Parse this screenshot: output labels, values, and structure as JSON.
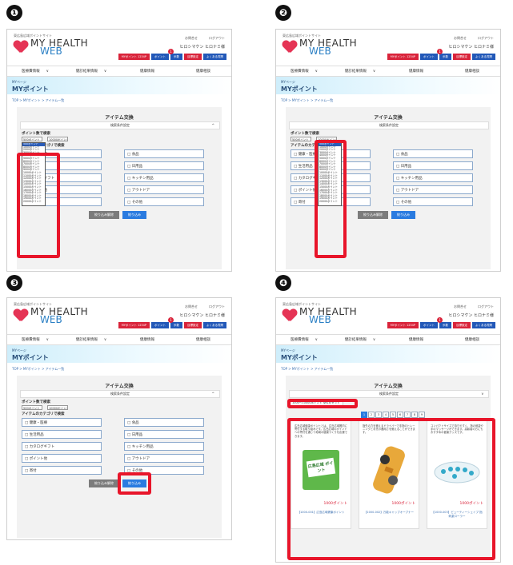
{
  "markers": [
    "❶",
    "❷",
    "❸",
    "❹"
  ],
  "header": {
    "tagline": "東広島広域ポイントサイト",
    "logo_main": "MY HEALTH",
    "logo_sub": "WEB",
    "top_link_1": "お問合せ",
    "top_link_2": "ログアウト",
    "user_line": "ヒロシマケン ヒロナミ様",
    "buttons": [
      "MYポイント 1234P",
      "ポイント",
      "歩数",
      "目標設定",
      "よくある質問"
    ],
    "badge": "1",
    "nav": [
      "医療費情報",
      "健診結果情報",
      "健康情報",
      "健康相談"
    ]
  },
  "page": {
    "band_small": "MYページ",
    "band_title": "MYポイント",
    "crumb": "TOP > MYポイント > アイテム一覧",
    "title": "アイテム交換",
    "subtitle": "検索条件設定",
    "points_label": "ポイント数で検索",
    "category_label": "アイテムのカテゴリで検索",
    "categories": [
      "健康・医療",
      "食品",
      "生活用品",
      "日用品",
      "カタログギフト",
      "キッチン用品",
      "ポイント他",
      "アウトドア",
      "寄付",
      "その他"
    ],
    "clear_label": "絞り込み解除",
    "search_label": "絞り込み",
    "select_from": "500ポイント",
    "select_to": "10000ポイント"
  },
  "dropdown_options": [
    "500ポイント",
    "1000ポイント",
    "2000ポイント",
    "3000ポイント",
    "4000ポイント",
    "5000ポイント",
    "6000ポイント",
    "7000ポイント",
    "8000ポイント",
    "9000ポイント",
    "10000ポイント",
    "11000ポイント",
    "12000ポイント",
    "13000ポイント",
    "14000ポイント",
    "15000ポイント",
    "16000ポイント",
    "17000ポイント",
    "18000ポイント",
    "19000ポイント",
    "20000ポイント"
  ],
  "result": {
    "filter_text": "1000～10000ポイント 全件をセット",
    "pages": [
      "1",
      "2",
      "3",
      "4",
      "5",
      "6",
      "7",
      "8",
      "9"
    ],
    "cards": [
      {
        "desc": "広島広域健康ポイントとは、広島広域圏内に寄付する取り組みです。広島広域のポイントへの寄付を通じて地域の健康づくりを応援できます。",
        "points": "1000ポイント",
        "name": "【1000-001】広島広域健康ポイント",
        "pic_text": "広島広域 ポイント"
      },
      {
        "desc": "指先の力を鍛えるドライバーで手指のトレーニングと手先の器用さを鍛えることができます。",
        "points": "1000ポイント",
        "name": "【1000-002】万能キャップオープナー",
        "pic_text": ""
      },
      {
        "desc": "コンパクトサイズで持ちやすく、指の刺激や手のマッサージができます。高齢者の方にもおすすめの健康グッズです。",
        "points": "1000ポイント",
        "name": "【1000-003】ピューティーシェイプ 指刺激ローラー",
        "pic_text": ""
      }
    ]
  },
  "colors": {
    "highlight": "#e8152a",
    "accent_blue": "#2a7be0",
    "brand_red": "#d9233a"
  }
}
